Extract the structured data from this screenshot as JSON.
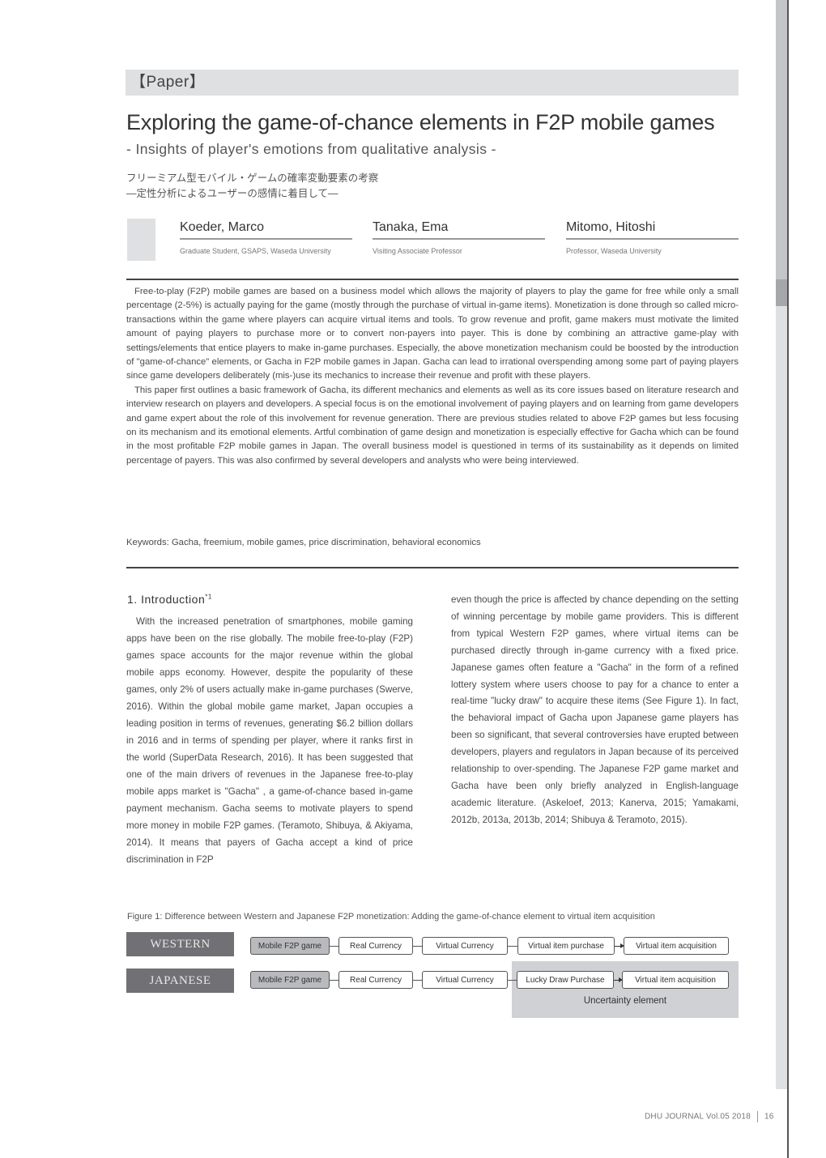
{
  "section_label": "【Paper】",
  "title": "Exploring the game-of-chance elements in F2P mobile games",
  "subtitle": "- Insights of player's emotions from qualitative analysis -",
  "japanese_title": {
    "line1": "フリーミアム型モバイル・ゲームの確率変動要素の考察",
    "line2": "―定性分析によるユーザーの感情に着目して―"
  },
  "authors": [
    {
      "name": "Koeder, Marco",
      "affiliation": "Graduate Student, GSAPS, Waseda University"
    },
    {
      "name": "Tanaka, Ema",
      "affiliation": "Visiting Associate Professor"
    },
    {
      "name": "Mitomo, Hitoshi",
      "affiliation": "Professor, Waseda University"
    }
  ],
  "abstract": {
    "paragraphs": [
      "Free-to-play (F2P) mobile games are based on a business model which allows the majority of players to play the game for free while only a small percentage (2-5%) is actually paying for the game (mostly through the purchase of virtual in-game items). Monetization is done through so called micro-transactions within the game where players can acquire virtual items and tools. To grow revenue and profit, game makers must motivate the limited amount of paying players to purchase more or to convert non-payers into payer. This is done by combining an attractive game-play with settings/elements that entice players to make in-game purchases. Especially, the above monetization mechanism could be boosted by the introduction of \"game-of-chance\" elements, or Gacha in F2P mobile games in Japan. Gacha can lead to irrational overspending among some part of paying players since game developers deliberately (mis-)use its mechanics to increase their revenue and profit with these players.",
      "This paper first outlines a basic framework of Gacha, its different mechanics and elements as well as its core issues based on literature research and interview research on players and developers. A special focus is on the emotional involvement of paying players and on learning from game developers and game expert about the role of this involvement for revenue generation. There are previous studies related to above F2P games but less focusing on its mechanism and its emotional elements. Artful combination of game design and monetization is especially effective for Gacha which can be found in the most profitable F2P mobile games in Japan. The overall business model is questioned in terms of its sustainability as it depends on limited percentage of payers. This was also confirmed by several developers and analysts who were being interviewed."
    ],
    "keywords": "Keywords: Gacha, freemium, mobile games, price discrimination, behavioral economics"
  },
  "introduction": {
    "heading": "1. Introduction",
    "footnote_mark": "*1",
    "left_column": "With the increased penetration of smartphones, mobile gaming apps have been on the rise globally. The mobile free-to-play (F2P) games space accounts for the major revenue within the global mobile apps economy. However, despite the popularity of these games, only 2% of users actually make in-game purchases (Swerve, 2016). Within the global mobile game market, Japan occupies a leading position in terms of revenues, generating $6.2 billion dollars in 2016 and in terms of spending per player, where it ranks first in the world (SuperData Research, 2016). It has been suggested that one of the main drivers of revenues in the Japanese free-to-play mobile apps market is \"Gacha\" , a game-of-chance based in-game payment mechanism. Gacha seems to motivate players to spend more money in mobile F2P games. (Teramoto, Shibuya, & Akiyama, 2014). It means that payers of Gacha accept a kind of price discrimination in F2P",
    "right_column": "even though the price is affected by chance depending on the setting of winning percentage by mobile game providers. This is different from typical Western F2P games, where virtual items can be purchased directly through in-game currency with a fixed price. Japanese games often feature a \"Gacha\" in the form of a refined lottery system where users choose to pay for a chance to enter a real-time \"lucky draw\" to acquire these items (See Figure 1). In fact, the behavioral impact of Gacha upon Japanese game players has been so significant, that several controversies have erupted between developers, players and regulators in Japan because of its perceived relationship to over-spending. The Japanese F2P game market and Gacha have been only briefly analyzed in English-language academic literature. (Askeloef, 2013; Kanerva, 2015; Yamakami, 2012b, 2013a, 2013b, 2014; Shibuya & Teramoto, 2015)."
  },
  "figure1": {
    "caption": "Figure 1: Difference between Western and Japanese F2P monetization: Adding the game-of-chance element to virtual item acquisition",
    "rows": [
      {
        "label": "WESTERN",
        "steps": [
          "Mobile F2P game",
          "Real Currency",
          "Virtual Currency",
          "Virtual item purchase",
          "Virtual item acquisition"
        ]
      },
      {
        "label": "JAPANESE",
        "steps": [
          "Mobile F2P game",
          "Real Currency",
          "Virtual Currency",
          "Lucky Draw Purchase",
          "Virtual item acquisition"
        ]
      }
    ],
    "highlight_label": "Uncertainty element"
  },
  "footer": {
    "journal": "DHU JOURNAL Vol.05  2018",
    "page": "16"
  }
}
